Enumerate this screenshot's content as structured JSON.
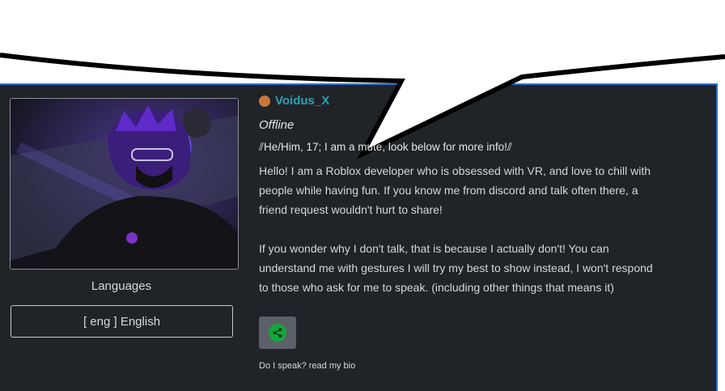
{
  "profile": {
    "username": "Voidus_X",
    "status": "Offline",
    "tagline": "⫽He/Him, 17; I am a mute, look below for more info!⫽",
    "bio_paragraph_1": "Hello! I am a Roblox developer who is obsessed with VR, and love to chill with people while having fun. If you know me from discord and talk often there, a friend request wouldn't hurt to share!",
    "bio_paragraph_2": "If you wonder why I don't talk, that is because I actually don't! You can understand me with gestures I will try my best to show instead, I won't respond to those who ask for me to speak.   (including other things that means it)",
    "status_color": "#c7773a",
    "username_color": "#2aa1b3"
  },
  "languages": {
    "label": "Languages",
    "value": "[ eng ] English"
  },
  "share": {
    "icon": "share-icon",
    "caption": "Do I speak? read my bio"
  },
  "colors": {
    "card_bg": "#202328",
    "card_border": "#2f6fce",
    "share_icon": "#12a83a"
  }
}
